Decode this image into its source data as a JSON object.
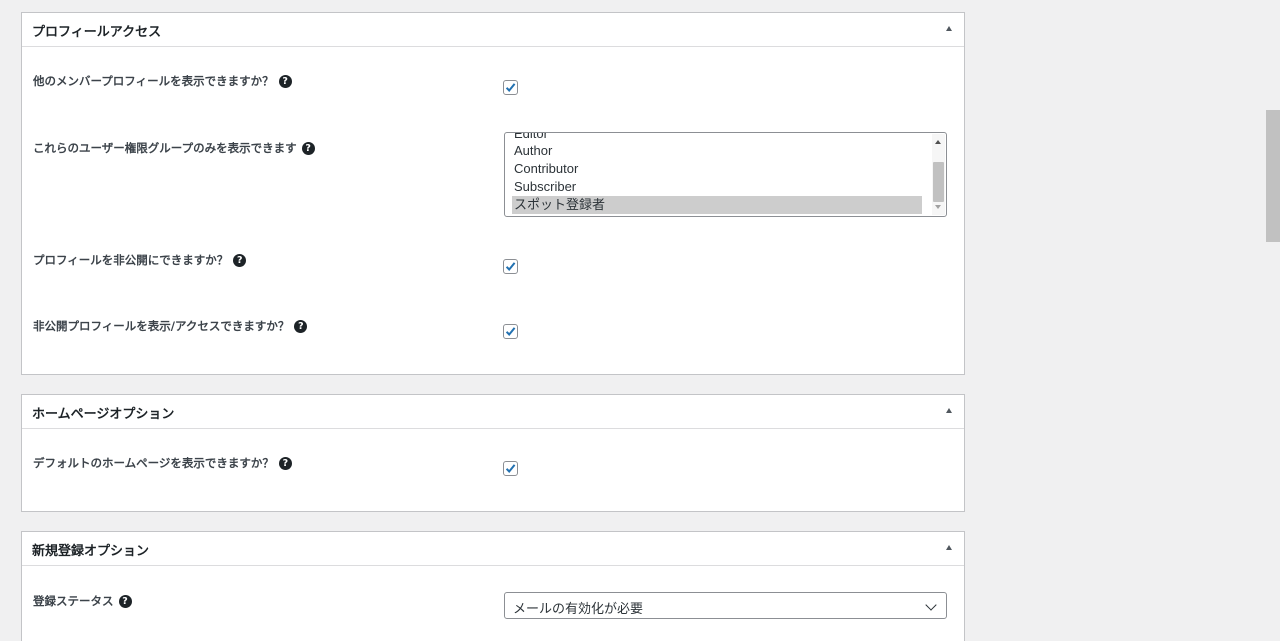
{
  "panels": {
    "profile_access": {
      "title": "プロフィールアクセス",
      "view_other_profiles": {
        "label": "他のメンバープロフィールを表示できますか？",
        "checked": true
      },
      "role_groups": {
        "label": "これらのユーザー権限グループのみを表示できます",
        "options": [
          "Editor",
          "Author",
          "Contributor",
          "Subscriber",
          "スポット登録者"
        ],
        "selected": "スポット登録者"
      },
      "make_private": {
        "label": "プロフィールを非公開にできますか？",
        "checked": true
      },
      "view_private": {
        "label": "非公開プロフィールを表示/アクセスできますか？",
        "checked": true
      }
    },
    "homepage_options": {
      "title": "ホームページオプション",
      "view_default_homepage": {
        "label": "デフォルトのホームページを表示できますか？",
        "checked": true
      }
    },
    "registration_options": {
      "title": "新規登録オプション",
      "registration_status": {
        "label": "登録ステータス",
        "value": "メールの有効化が必要"
      }
    }
  },
  "help_icon_glyph": "?",
  "colors": {
    "checkmark": "#2271b1",
    "background": "#f0f0f1"
  }
}
